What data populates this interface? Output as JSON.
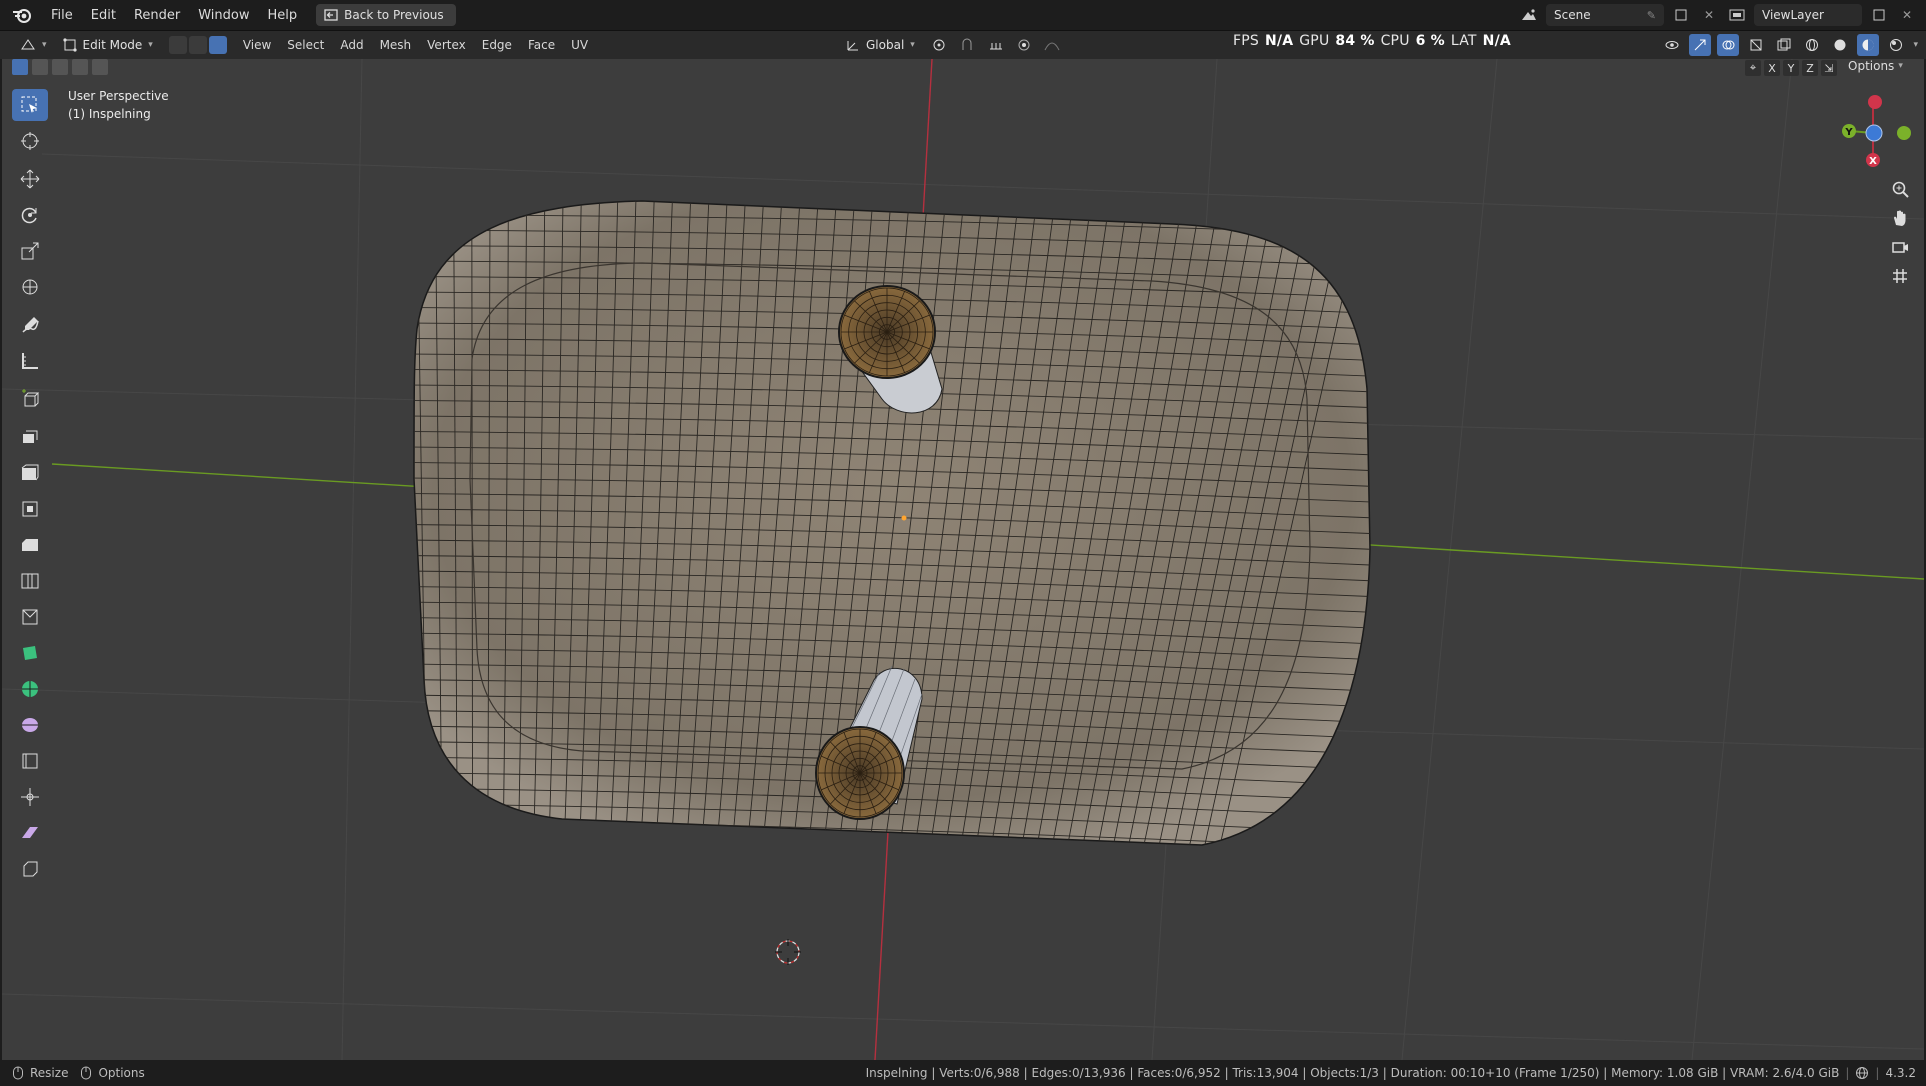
{
  "topbar": {
    "menus": [
      "File",
      "Edit",
      "Render",
      "Window",
      "Help"
    ],
    "back_button": "Back to Previous",
    "scene_name": "Scene",
    "view_layer_name": "ViewLayer"
  },
  "header": {
    "mode": "Edit Mode",
    "menus": [
      "View",
      "Select",
      "Add",
      "Mesh",
      "Vertex",
      "Edge",
      "Face",
      "UV"
    ],
    "orientation": "Global",
    "perf": {
      "fps_label": "FPS",
      "fps_value": "N/A",
      "gpu_label": "GPU",
      "gpu_value": "84 %",
      "cpu_label": "CPU",
      "cpu_value": "6 %",
      "lat_label": "LAT",
      "lat_value": "N/A"
    },
    "options_label": "Options",
    "axes": [
      "X",
      "Y",
      "Z"
    ]
  },
  "viewport": {
    "view_name": "User Perspective",
    "object_name": "(1) Inspelning",
    "gizmo": {
      "x": "X",
      "y": "Y",
      "z": "Z"
    }
  },
  "status": {
    "left": [
      "Resize",
      "Options"
    ],
    "right": "Inspelning | Verts:0/6,988 | Edges:0/13,936 | Faces:0/6,952 | Tris:13,904 | Objects:1/3 | Duration: 00:10+10 (Frame 1/250) | Memory: 1.08 GiB | VRAM: 2.6/4.0 GiB",
    "version": "4.3.2"
  },
  "colors": {
    "accent": "#4772b3",
    "viewport_bg": "#3d3d3d",
    "mesh_fill": "#8a8072",
    "axis_x": "#d1354b",
    "axis_y": "#7bb12a",
    "axis_z": "#3d7ad6"
  },
  "icons": [
    "blender-logo",
    "back-icon",
    "scene-icon",
    "viewlayer-icon",
    "select-box-icon",
    "cursor-icon",
    "move-icon",
    "rotate-icon",
    "scale-icon",
    "transform-icon",
    "annotate-icon",
    "measure-icon",
    "add-cube-icon",
    "extrude-icon",
    "inset-icon",
    "bevel-icon",
    "loopcut-icon",
    "knife-icon",
    "polybuild-icon",
    "spin-icon",
    "smooth-icon",
    "edge-slide-icon",
    "shrink-icon",
    "shear-icon",
    "rip-icon",
    "zoom-icon",
    "hand-icon",
    "camera-icon",
    "grid-icon"
  ]
}
